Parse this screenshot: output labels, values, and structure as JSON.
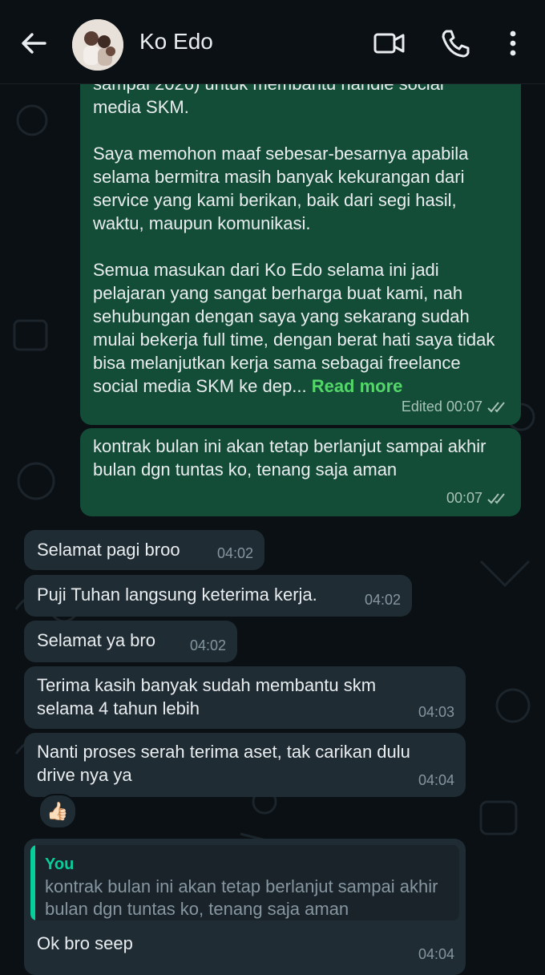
{
  "header": {
    "contact_name": "Ko Edo"
  },
  "messages": {
    "m1": {
      "clipped_top": "sampai 2026) untuk membantu handle social",
      "line2": "media SKM.",
      "p2": "Saya memohon maaf sebesar-besarnya apabila selama bermitra masih banyak kekurangan dari service yang kami berikan, baik dari segi hasil, waktu, maupun komunikasi.",
      "p3": "Semua masukan dari Ko Edo selama ini jadi pelajaran yang sangat berharga buat kami, nah sehubungan dengan saya yang sekarang sudah mulai bekerja full time, dengan berat hati saya tidak bisa melanjutkan kerja sama sebagai freelance social media SKM ke dep...",
      "read_more": "Read more",
      "meta": "Edited 00:07"
    },
    "m2": {
      "text": "kontrak bulan ini akan tetap berlanjut sampai akhir bulan dgn tuntas ko, tenang saja aman",
      "time": "00:07"
    },
    "m3": {
      "text": "Selamat pagi broo",
      "time": "04:02"
    },
    "m4": {
      "text": "Puji Tuhan langsung keterima kerja.",
      "time": "04:02"
    },
    "m5": {
      "text": "Selamat ya bro",
      "time": "04:02"
    },
    "m6": {
      "text": "Terima kasih banyak sudah membantu skm selama 4 tahun lebih",
      "time": "04:03"
    },
    "m7": {
      "text": "Nanti proses serah terima aset, tak carikan dulu drive nya ya",
      "time": "04:04",
      "reaction": "👍🏻"
    },
    "m8": {
      "quote_author": "You",
      "quote_text": "kontrak bulan ini akan tetap berlanjut sampai akhir bulan dgn tuntas ko, tenang saja aman",
      "text": "Ok bro seep",
      "time": "04:04"
    }
  },
  "colors": {
    "background": "#0b1014",
    "outgoing_bubble": "#134d37",
    "incoming_bubble": "#1f2c34",
    "accent": "#53d769",
    "quote_accent": "#06cf9c"
  },
  "icons": [
    "back-arrow-icon",
    "video-call-icon",
    "phone-icon",
    "more-vert-icon",
    "double-check-icon"
  ]
}
